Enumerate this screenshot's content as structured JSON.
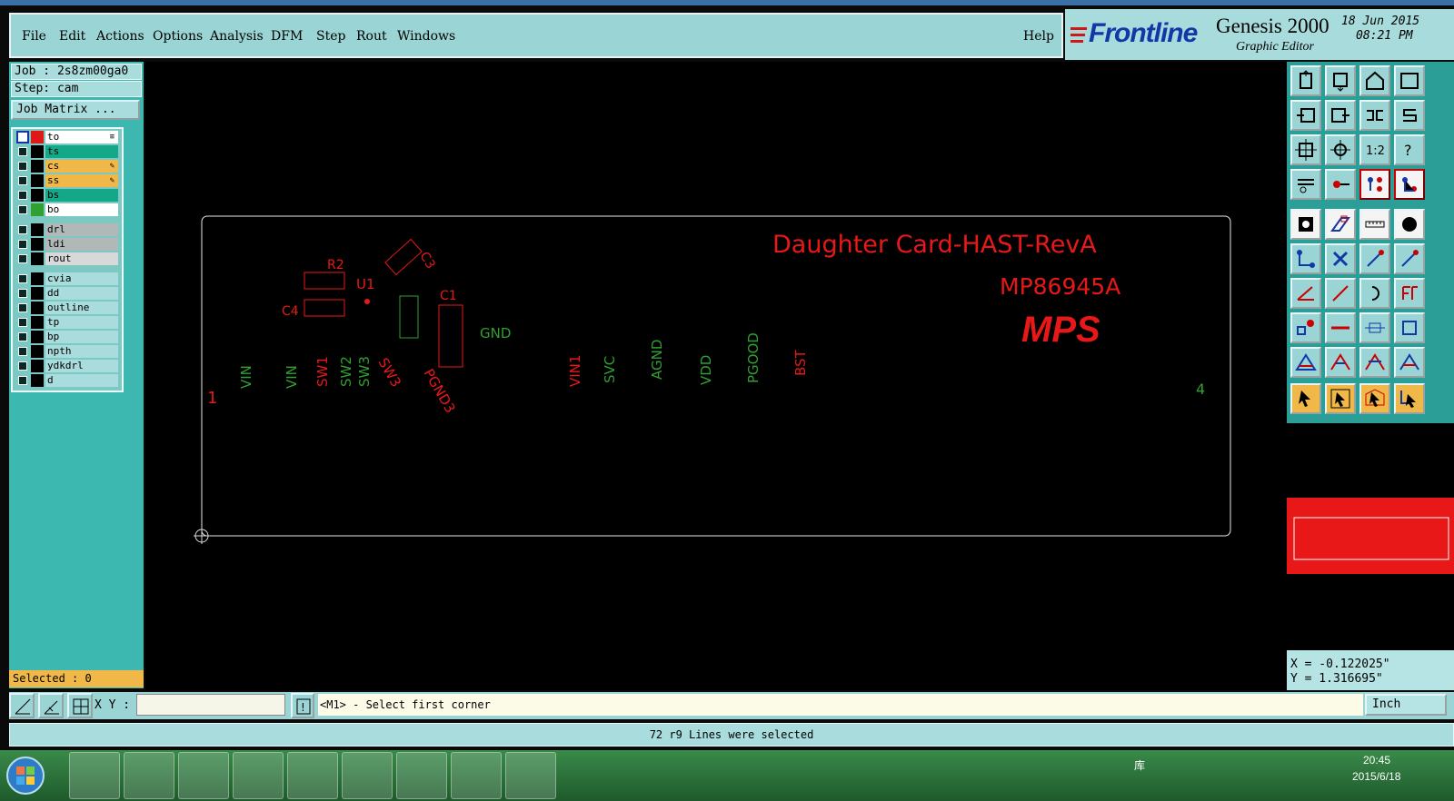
{
  "menubar": {
    "items": [
      "File",
      "Edit",
      "Actions",
      "Options",
      "Analysis",
      "DFM",
      "Step",
      "Rout",
      "Windows"
    ],
    "help": "Help"
  },
  "brand": {
    "logo": "Frontline",
    "product": "Genesis 2000",
    "subtitle": "Graphic Editor",
    "date": "18 Jun 2015",
    "time": "08:21 PM"
  },
  "panel": {
    "job": "Job : 2s8zm00ga0",
    "step": "Step: cam",
    "job_matrix": "Job Matrix ...",
    "selected": "Selected : 0",
    "layers": [
      {
        "name": "to",
        "color": "#ffffff",
        "swatch": "#e01818",
        "checked": true,
        "mark": "≡"
      },
      {
        "name": "ts",
        "color": "#14a888",
        "swatch": "#000000",
        "checked": false,
        "mark": ""
      },
      {
        "name": "cs",
        "color": "#f0b848",
        "swatch": "#000000",
        "checked": false,
        "mark": "✎"
      },
      {
        "name": "ss",
        "color": "#f0b848",
        "swatch": "#000000",
        "checked": false,
        "mark": "✎"
      },
      {
        "name": "bs",
        "color": "#14a888",
        "swatch": "#000000",
        "checked": false,
        "mark": ""
      },
      {
        "name": "bo",
        "color": "#ffffff",
        "swatch": "#30a030",
        "checked": false,
        "mark": ""
      },
      {
        "name": "drl",
        "color": "#b0b8b8",
        "swatch": "#000000",
        "checked": false,
        "mark": ""
      },
      {
        "name": "ldi",
        "color": "#b0b8b8",
        "swatch": "#000000",
        "checked": false,
        "mark": ""
      },
      {
        "name": "rout",
        "color": "#d8d8d8",
        "swatch": "#000000",
        "checked": false,
        "mark": ""
      },
      {
        "name": "cvia",
        "color": "#a9dcdc",
        "swatch": "#000000",
        "checked": false,
        "mark": ""
      },
      {
        "name": "dd",
        "color": "#a9dcdc",
        "swatch": "#000000",
        "checked": false,
        "mark": ""
      },
      {
        "name": "outline",
        "color": "#a9dcdc",
        "swatch": "#000000",
        "checked": false,
        "mark": ""
      },
      {
        "name": "tp",
        "color": "#a9dcdc",
        "swatch": "#000000",
        "checked": false,
        "mark": ""
      },
      {
        "name": "bp",
        "color": "#a9dcdc",
        "swatch": "#000000",
        "checked": false,
        "mark": ""
      },
      {
        "name": "npth",
        "color": "#a9dcdc",
        "swatch": "#000000",
        "checked": false,
        "mark": ""
      },
      {
        "name": "ydkdrl",
        "color": "#a9dcdc",
        "swatch": "#000000",
        "checked": false,
        "mark": ""
      },
      {
        "name": "d",
        "color": "#a9dcdc",
        "swatch": "#000000",
        "checked": false,
        "mark": ""
      }
    ]
  },
  "board": {
    "title": "Daughter Card-HAST-RevA",
    "part": "MP86945A",
    "logo": "MPS",
    "refdes": [
      "R2",
      "C3",
      "U1",
      "C1",
      "C4"
    ],
    "pins_red": [
      "SW1",
      "SW3",
      "PGND3",
      "VIN1",
      "BST"
    ],
    "pins_mixed": [
      "VIN",
      "VIN",
      "SW2",
      "SW3",
      "GND",
      "SVC",
      "AGND",
      "VDD",
      "PGOOD"
    ],
    "marker_left": "1",
    "marker_right": "4"
  },
  "coords": {
    "x": "X = -0.122025\"",
    "y": "Y = 1.316695\""
  },
  "cmd": {
    "xy_label": "X Y :",
    "prompt": "<M1> - Select first corner",
    "units": "Inch"
  },
  "status": "72 r9 Lines were selected",
  "taskbar": {
    "tray_text": "库",
    "time": "20:45",
    "date": "2015/6/18"
  }
}
